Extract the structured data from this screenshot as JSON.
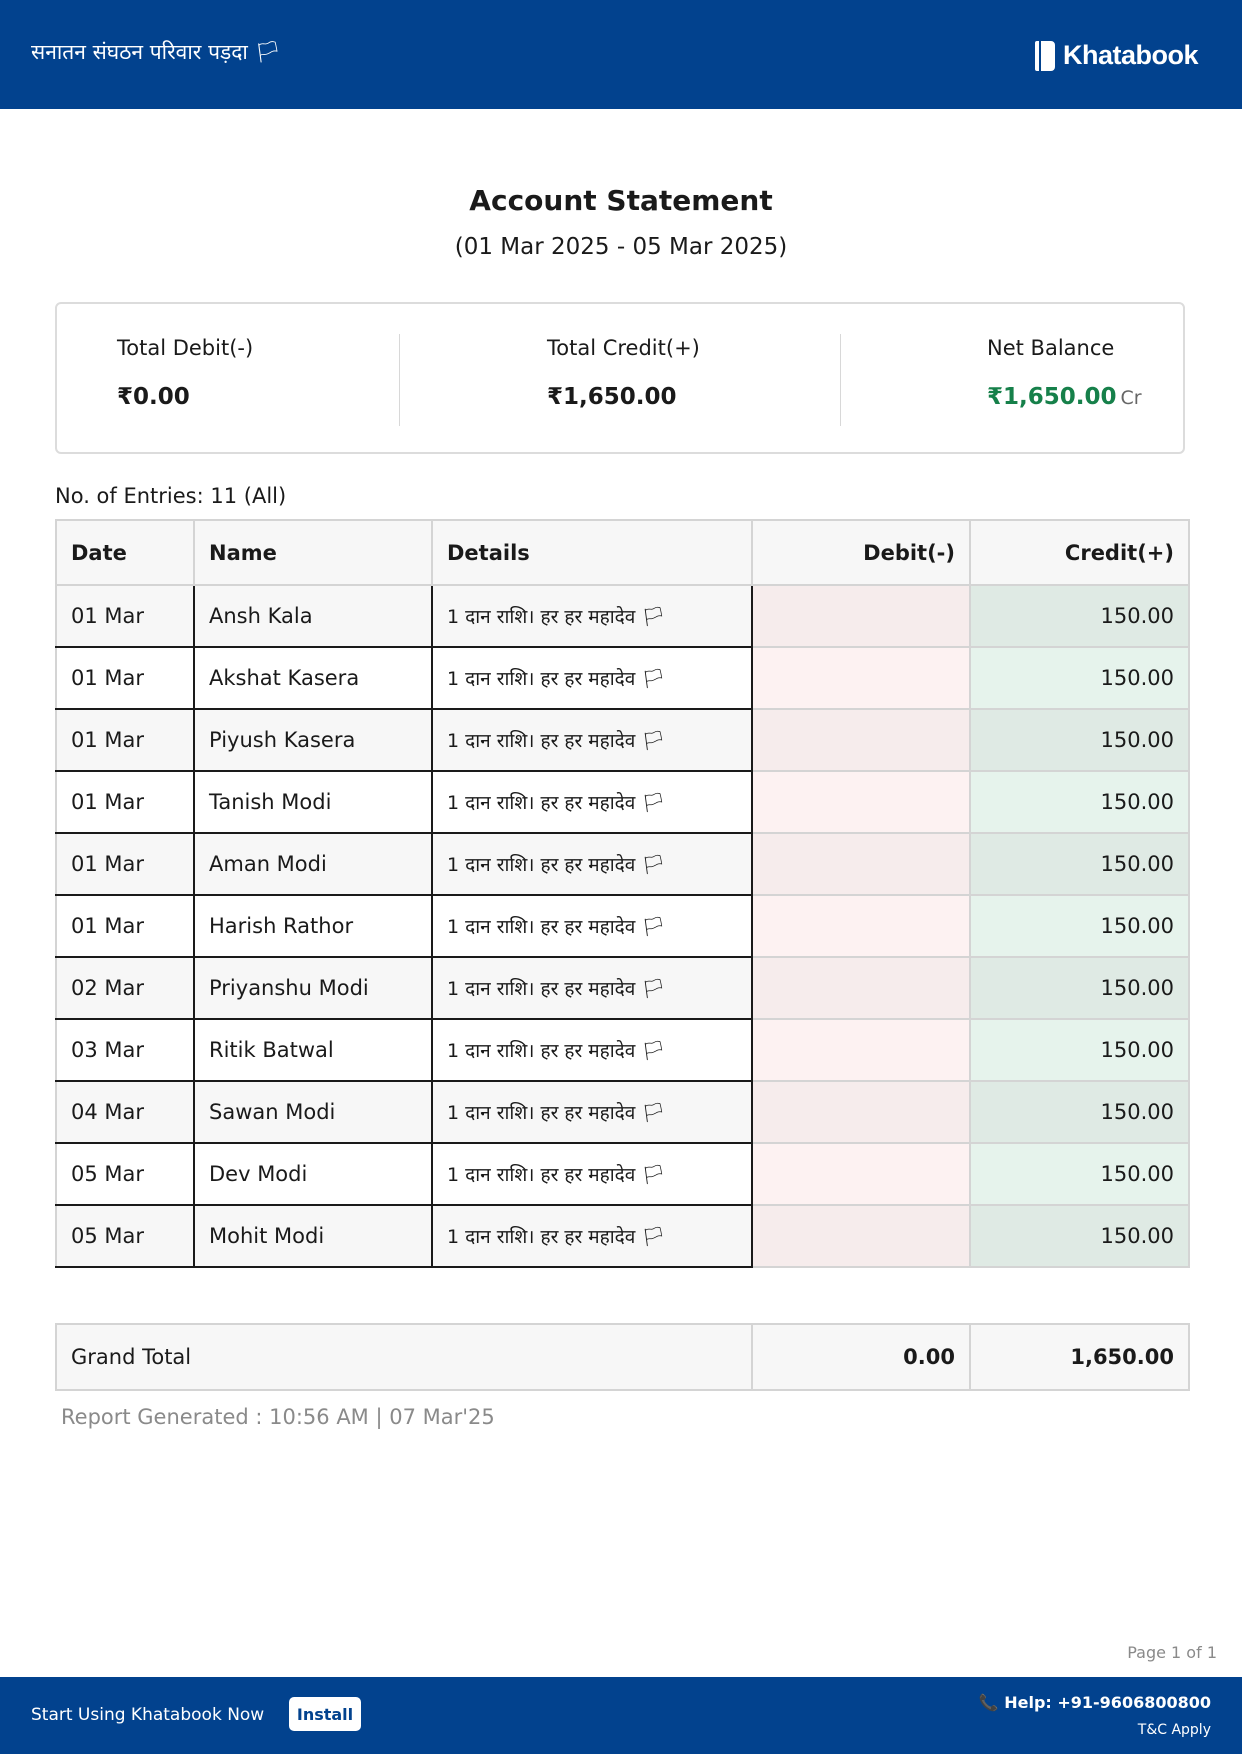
{
  "header": {
    "business_name": "सनातन संघठन परिवार पड़दा 🏳",
    "brand": "Khatabook"
  },
  "statement": {
    "title": "Account Statement",
    "period": "(01 Mar 2025 - 05 Mar 2025)"
  },
  "summary": {
    "total_debit_label": "Total Debit(-)",
    "total_debit_value": "₹0.00",
    "total_credit_label": "Total Credit(+)",
    "total_credit_value": "₹1,650.00",
    "net_balance_label": "Net Balance",
    "net_balance_value": "₹1,650.00",
    "net_balance_suffix": "Cr",
    "net_balance_color": "#16804a"
  },
  "entries": {
    "label": "No. of Entries:",
    "value": "11 (All)"
  },
  "table": {
    "headers": [
      "Date",
      "Name",
      "Details",
      "Debit(-)",
      "Credit(+)"
    ],
    "rows": [
      {
        "date": "01 Mar",
        "name": "Ansh Kala",
        "details": "1 दान राशि। हर हर महादेव 🏳",
        "debit": "",
        "credit": "150.00"
      },
      {
        "date": "01 Mar",
        "name": "Akshat Kasera",
        "details": "1 दान राशि। हर हर महादेव 🏳",
        "debit": "",
        "credit": "150.00"
      },
      {
        "date": "01 Mar",
        "name": "Piyush Kasera",
        "details": "1 दान राशि। हर हर महादेव 🏳",
        "debit": "",
        "credit": "150.00"
      },
      {
        "date": "01 Mar",
        "name": "Tanish Modi",
        "details": "1 दान राशि। हर हर महादेव 🏳",
        "debit": "",
        "credit": "150.00"
      },
      {
        "date": "01 Mar",
        "name": "Aman Modi",
        "details": "1 दान राशि। हर हर महादेव 🏳",
        "debit": "",
        "credit": "150.00"
      },
      {
        "date": "01 Mar",
        "name": "Harish Rathor",
        "details": "1 दान राशि। हर हर महादेव 🏳",
        "debit": "",
        "credit": "150.00"
      },
      {
        "date": "02 Mar",
        "name": "Priyanshu Modi",
        "details": "1 दान राशि। हर हर महादेव 🏳",
        "debit": "",
        "credit": "150.00"
      },
      {
        "date": "03 Mar",
        "name": "Ritik Batwal",
        "details": "1 दान राशि। हर हर महादेव 🏳",
        "debit": "",
        "credit": "150.00"
      },
      {
        "date": "04 Mar",
        "name": "Sawan Modi",
        "details": "1 दान राशि। हर हर महादेव 🏳",
        "debit": "",
        "credit": "150.00"
      },
      {
        "date": "05 Mar",
        "name": "Dev Modi",
        "details": "1 दान राशि। हर हर महादेव 🏳",
        "debit": "",
        "credit": "150.00"
      },
      {
        "date": "05 Mar",
        "name": "Mohit Modi",
        "details": "1 दान राशि। हर हर महादेव 🏳",
        "debit": "",
        "credit": "150.00"
      }
    ]
  },
  "grand_total": {
    "label": "Grand Total",
    "debit": "0.00",
    "credit": "1,650.00"
  },
  "report_generated": "Report Generated : 10:56 AM | 07 Mar'25",
  "page_number": "Page 1 of 1",
  "footer": {
    "cta": "Start Using Khatabook Now",
    "install_label": "Install",
    "help_icon": "phone-icon",
    "help": "📞 Help: +91-9606800800",
    "tc": "T&C Apply"
  }
}
